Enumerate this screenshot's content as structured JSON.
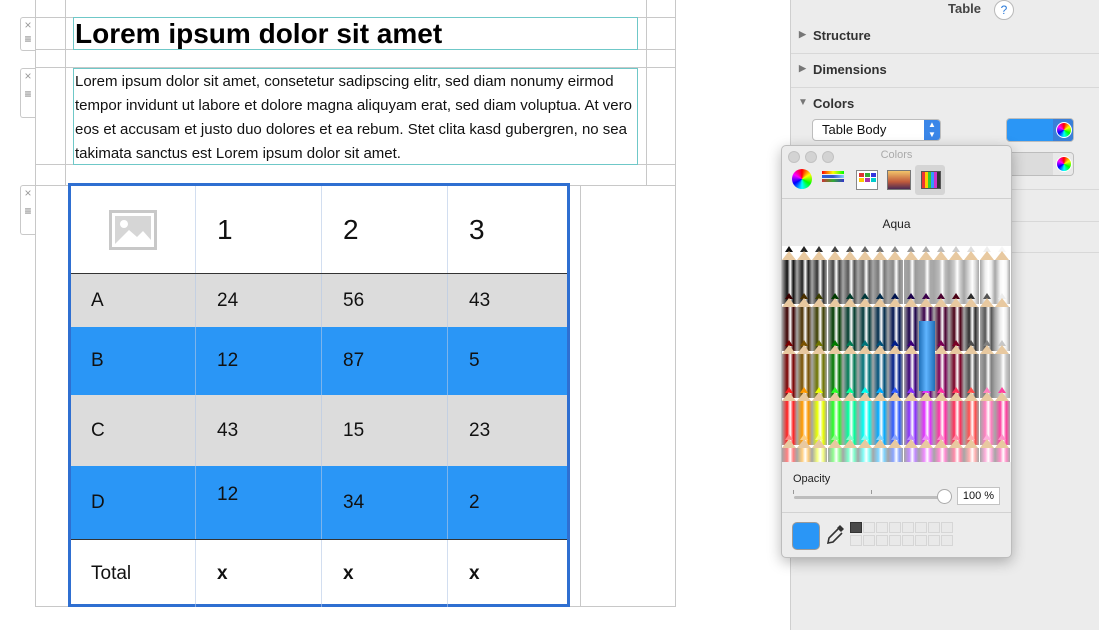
{
  "editor": {
    "heading": "Lorem ipsum dolor sit amet",
    "paragraph": "Lorem ipsum dolor sit amet, consetetur sadipscing elitr, sed diam nonumy eirmod tempor invidunt ut labore et dolore magna aliquyam erat, sed diam voluptua. At vero eos et accusam et justo duo dolores et ea rebum. Stet clita kasd gubergren, no sea takimata sanctus est Lorem ipsum dolor sit amet.",
    "handle_close": "×",
    "handle_menu": "≡"
  },
  "table": {
    "header": [
      "image-placeholder",
      "1",
      "2",
      "3"
    ],
    "rows": [
      {
        "label": "A",
        "values": [
          "24",
          "56",
          "43"
        ],
        "style": "gray"
      },
      {
        "label": "B",
        "values": [
          "12",
          "87",
          "5"
        ],
        "style": "blue"
      },
      {
        "label": "C",
        "values": [
          "43",
          "15",
          "23"
        ],
        "style": "gray"
      },
      {
        "label": "D",
        "values": [
          "12",
          "34",
          "2"
        ],
        "style": "blue"
      }
    ],
    "footer": {
      "label": "Total",
      "values": [
        "x",
        "x",
        "x"
      ]
    },
    "colors": {
      "border": "#2f6fd1",
      "gray": "#dcdcdc",
      "blue": "#2a96f6"
    }
  },
  "inspector": {
    "title": "Table",
    "help": "?",
    "sections": [
      "Structure",
      "Dimensions",
      "Colors"
    ],
    "colors_select": "Table Body",
    "swatch_color": "#2a96f6"
  },
  "color_panel": {
    "title": "Colors",
    "selected_color_name": "Aqua",
    "opacity_label": "Opacity",
    "opacity_value": "100 %",
    "current_color": "#2a96f6"
  }
}
